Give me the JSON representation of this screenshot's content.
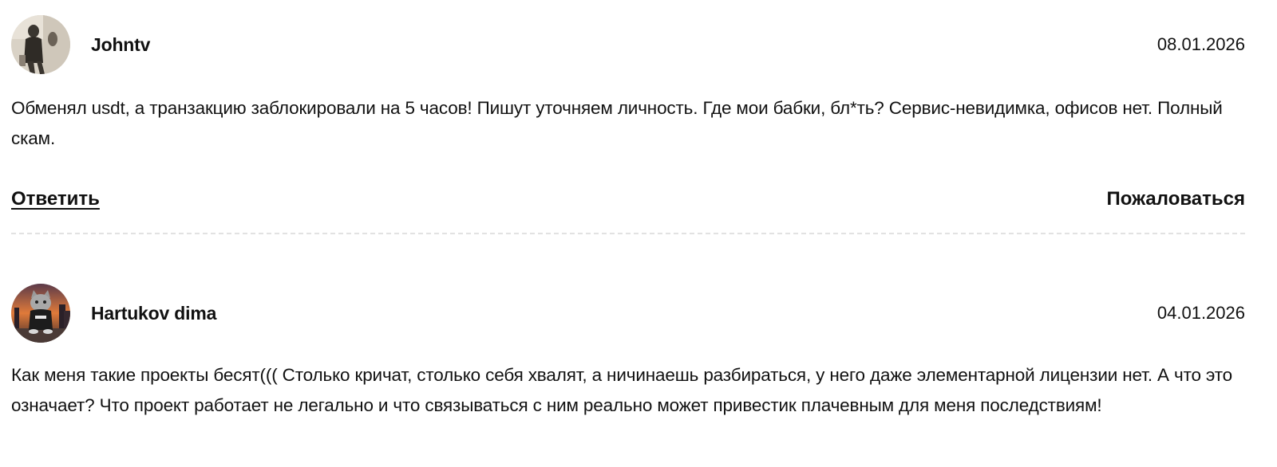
{
  "comments": [
    {
      "author": "Johntv",
      "date": "08.01.2026",
      "text": "Обменял usdt, а транзакцию заблокировали на 5 часов! Пишут уточняем личность. Где мои бабки, бл*ть? Сервис-невидимка, офисов нет. Полный скам.",
      "avatar_icon": "user-photo-avatar"
    },
    {
      "author": "Hartukov dima",
      "date": "04.01.2026",
      "text": "Как меня такие проекты бесят((( Столько кричат, столько себя хвалят, а ничинаешь разбираться, у него даже элементарной лицензии нет. А что это означает? Что проект работает не легально и что связываться с ним реально может привестик плачевным для меня последствиям!",
      "avatar_icon": "cat-avatar"
    }
  ],
  "actions": {
    "reply_label": "Ответить",
    "report_label": "Пожаловаться"
  }
}
